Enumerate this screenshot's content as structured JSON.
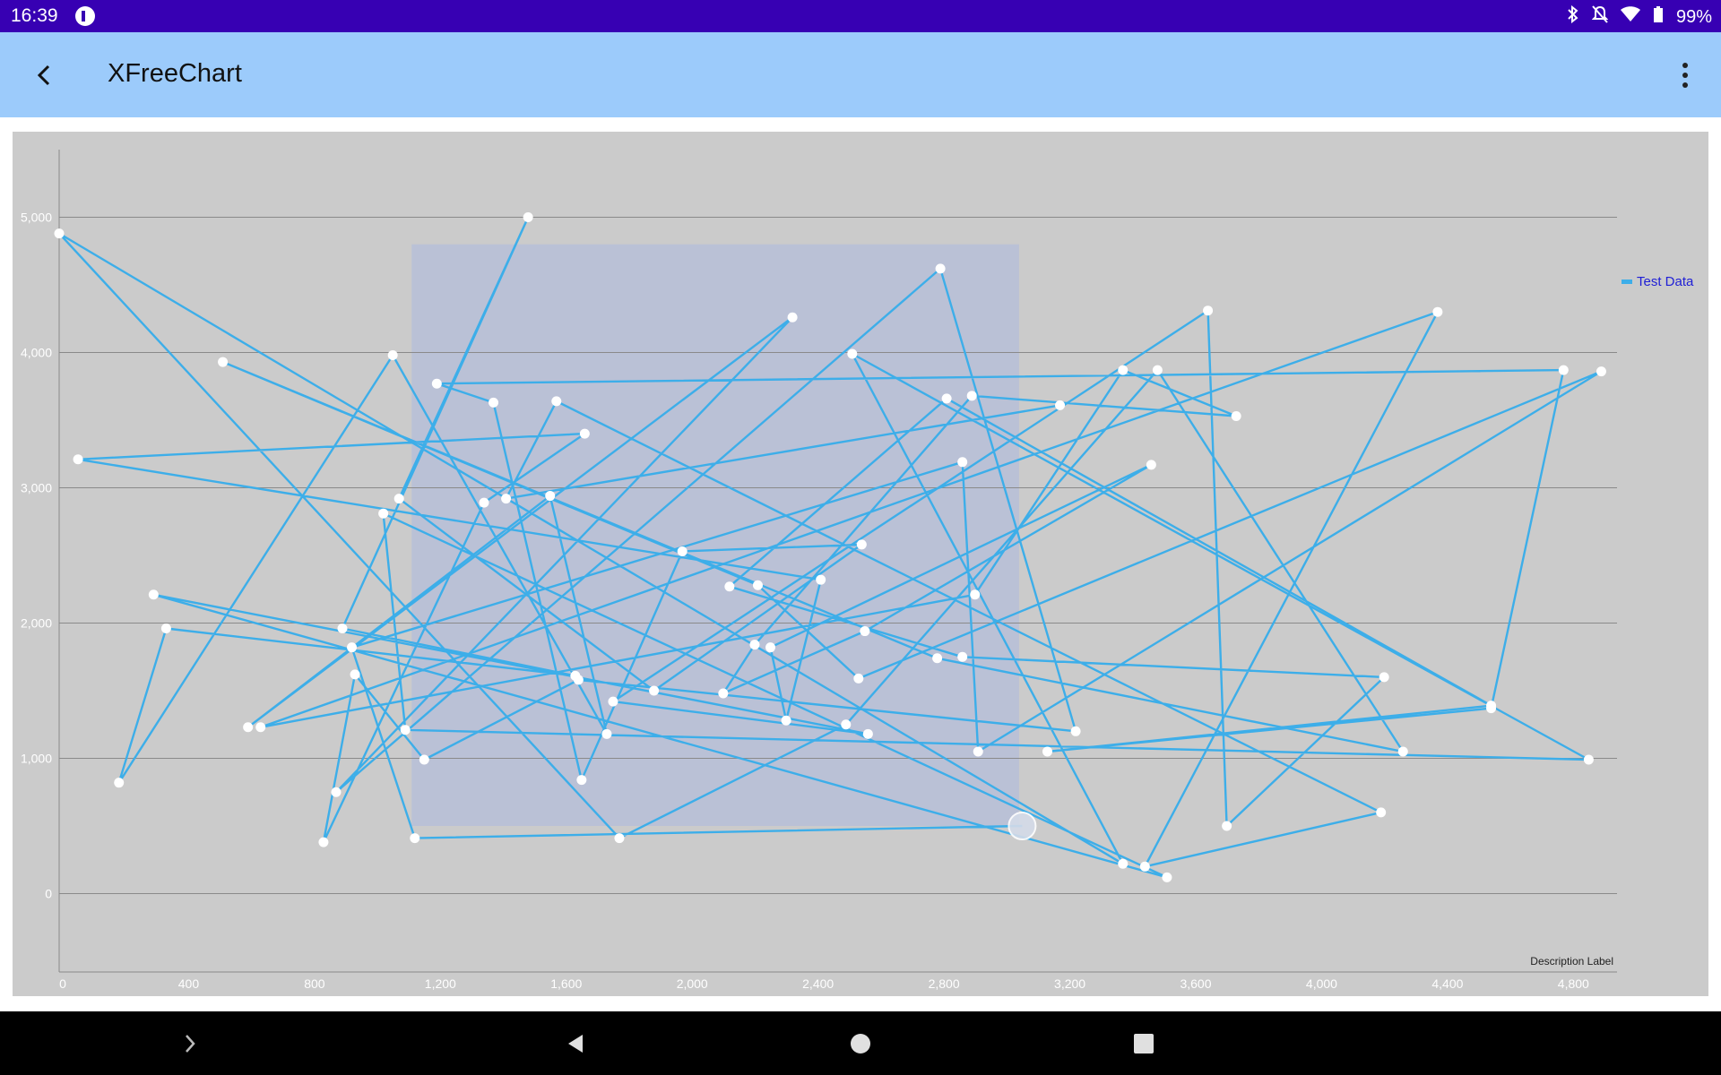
{
  "status": {
    "time": "16:39",
    "battery": "99%",
    "icons": [
      "bluetooth-icon",
      "notifications-off-icon",
      "wifi-icon",
      "battery-icon"
    ]
  },
  "appbar": {
    "title": "XFreeChart",
    "back_icon": "back-arrow-icon",
    "menu_icon": "more-vert-icon"
  },
  "chart_data": {
    "type": "line",
    "series": [
      {
        "name": "Test Data",
        "color": "#3daee9",
        "points": [
          [
            3060,
            500
          ],
          [
            1130,
            410
          ],
          [
            930,
            1820
          ],
          [
            2870,
            3190
          ],
          [
            2920,
            1050
          ],
          [
            4900,
            3860
          ],
          [
            2540,
            1590
          ],
          [
            2220,
            2280
          ],
          [
            520,
            3930
          ],
          [
            2790,
            1740
          ],
          [
            4270,
            1050
          ],
          [
            3490,
            3870
          ],
          [
            2500,
            1250
          ],
          [
            1780,
            410
          ],
          [
            0,
            4880
          ],
          [
            3380,
            220
          ],
          [
            2520,
            3990
          ],
          [
            4860,
            990
          ],
          [
            1100,
            1210
          ],
          [
            1030,
            2810
          ],
          [
            3520,
            120
          ],
          [
            300,
            2210
          ],
          [
            2570,
            1180
          ],
          [
            1760,
            1420
          ],
          [
            3650,
            4310
          ],
          [
            3710,
            500
          ],
          [
            4210,
            1600
          ],
          [
            2870,
            1750
          ],
          [
            2130,
            2270
          ],
          [
            2820,
            3660
          ],
          [
            4550,
            1390
          ],
          [
            3140,
            1050
          ],
          [
            4550,
            1370
          ],
          [
            4780,
            3870
          ],
          [
            1200,
            3770
          ],
          [
            1380,
            3630
          ],
          [
            1660,
            840
          ],
          [
            1980,
            2530
          ],
          [
            2550,
            2580
          ],
          [
            1890,
            1500
          ],
          [
            1080,
            2920
          ],
          [
            1490,
            5000
          ],
          [
            900,
            1960
          ],
          [
            1640,
            1610
          ],
          [
            340,
            1960
          ],
          [
            190,
            820
          ],
          [
            1060,
            3980
          ],
          [
            1740,
            1180
          ],
          [
            1560,
            2940
          ],
          [
            600,
            1230
          ],
          [
            2330,
            4260
          ],
          [
            880,
            750
          ],
          [
            2800,
            4620
          ],
          [
            3230,
            1200
          ],
          [
            1650,
            1580
          ],
          [
            1160,
            990
          ],
          [
            940,
            1620
          ],
          [
            840,
            380
          ],
          [
            1350,
            2890
          ],
          [
            1670,
            3400
          ],
          [
            60,
            3210
          ],
          [
            2420,
            2320
          ],
          [
            2310,
            1280
          ],
          [
            2260,
            1820
          ],
          [
            3470,
            3170
          ],
          [
            2560,
            1940
          ],
          [
            2110,
            1480
          ],
          [
            2210,
            1840
          ],
          [
            2900,
            3680
          ],
          [
            3740,
            3530
          ],
          [
            3380,
            3870
          ],
          [
            2910,
            2210
          ],
          [
            640,
            1230
          ],
          [
            4380,
            4300
          ],
          [
            3450,
            200
          ],
          [
            4200,
            600
          ],
          [
            1580,
            3640
          ],
          [
            1420,
            2920
          ],
          [
            3180,
            3610
          ]
        ]
      }
    ],
    "x_ticks": [
      "0",
      "400",
      "800",
      "1,200",
      "1,600",
      "2,000",
      "2,400",
      "2,800",
      "3,200",
      "3,600",
      "4,000",
      "4,400",
      "4,800"
    ],
    "y_ticks": [
      "0",
      "1,000",
      "2,000",
      "3,000",
      "4,000",
      "5,000"
    ],
    "xlim": [
      0,
      4950
    ],
    "ylim": [
      -500,
      5500
    ],
    "description": "Description Label",
    "legend_position": "top-right",
    "highlight_box": {
      "x": [
        1120,
        3050
      ],
      "y": [
        500,
        4800
      ]
    },
    "grid": true,
    "colors": {
      "background": "#cbcbcb",
      "grid": "#8a8a8a",
      "line": "#3daee9",
      "point": "#ffffff",
      "highlight": "#b7c0d8",
      "legend_text": "#1f1fd6"
    }
  },
  "navbar": {
    "icons": [
      "chevron-right-icon",
      "back-triangle-icon",
      "home-circle-icon",
      "recents-square-icon"
    ]
  }
}
